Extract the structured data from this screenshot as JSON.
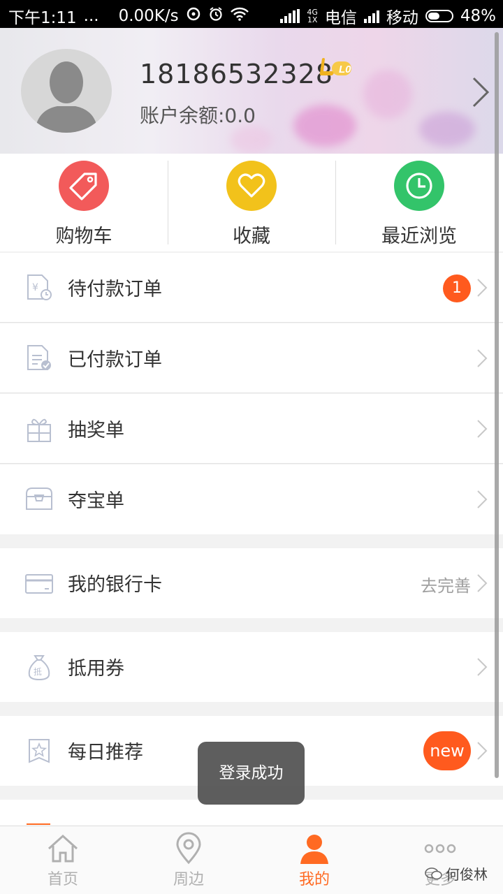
{
  "status_bar": {
    "time": "下午1:11",
    "dots": "...",
    "speed": "0.00K/s",
    "network_type_top": "4G",
    "network_type_bottom": "1X",
    "carrier1": "电信",
    "carrier2": "移动",
    "battery": "48%"
  },
  "profile": {
    "phone": "18186532328",
    "level": "L0",
    "balance": "账户余额:0.0"
  },
  "shortcuts": [
    {
      "label": "购物车",
      "color": "#f25a5a",
      "icon": "tag-icon"
    },
    {
      "label": "收藏",
      "color": "#f2c21b",
      "icon": "heart-icon"
    },
    {
      "label": "最近浏览",
      "color": "#33c46a",
      "icon": "clock-icon"
    }
  ],
  "menu": {
    "pending_orders": {
      "label": "待付款订单",
      "badge": "1"
    },
    "paid_orders": {
      "label": "已付款订单"
    },
    "lottery": {
      "label": "抽奖单"
    },
    "treasure": {
      "label": "夺宝单"
    },
    "bank_card": {
      "label": "我的银行卡",
      "hint": "去完善"
    },
    "coupon": {
      "label": "抵用券"
    },
    "daily": {
      "label": "每日推荐",
      "badge": "new"
    }
  },
  "toast": {
    "text": "登录成功"
  },
  "tabs": [
    {
      "label": "首页",
      "icon": "home-icon"
    },
    {
      "label": "周边",
      "icon": "location-pin-icon"
    },
    {
      "label": "我的",
      "icon": "user-icon",
      "active": true
    },
    {
      "label": "更多",
      "icon": "more-dots-icon"
    }
  ],
  "watermark": "何俊林",
  "colors": {
    "accent": "#ff6a22",
    "badge": "#ff5a1e"
  }
}
